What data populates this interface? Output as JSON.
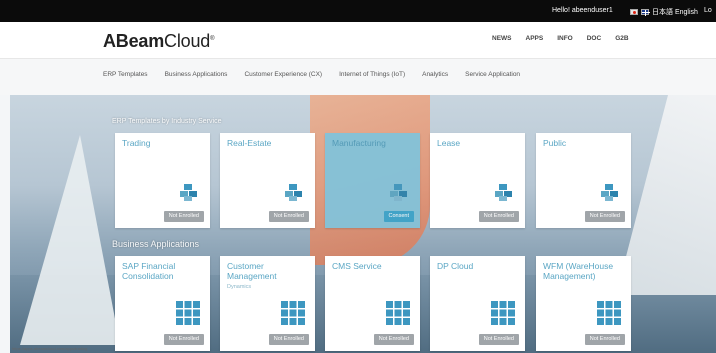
{
  "topbar": {
    "greeting": "Hello! abeenduser1",
    "languages": "日本語 English",
    "logout": "Lo"
  },
  "header": {
    "logo_main": "ABeam",
    "logo_sub": "Cloud",
    "logo_mark": "®",
    "nav": [
      "NEWS",
      "APPS",
      "INFO",
      "DOC",
      "G2B"
    ]
  },
  "categories": [
    "ERP Templates",
    "Business Applications",
    "Customer Experience (CX)",
    "Internet of Things (IoT)",
    "Analytics",
    "Service Application"
  ],
  "sections": {
    "industry": "ERP Templates by Industry Service",
    "business": "Business Applications"
  },
  "industry_tiles": [
    {
      "label": "Trading",
      "button": "Not Enrolled",
      "active": false
    },
    {
      "label": "Real-Estate",
      "button": "Not Enrolled",
      "active": false
    },
    {
      "label": "Manufacturing",
      "button": "Consent",
      "active": true
    },
    {
      "label": "Lease",
      "button": "Not Enrolled",
      "active": false
    },
    {
      "label": "Public",
      "button": "Not Enrolled",
      "active": false
    }
  ],
  "business_tiles": [
    {
      "label": "SAP Financial Consolidation",
      "sub": "",
      "button": "Not Enrolled"
    },
    {
      "label": "Customer Management",
      "sub": "Dynamics",
      "button": "Not Enrolled"
    },
    {
      "label": "CMS Service",
      "sub": "",
      "button": "Not Enrolled"
    },
    {
      "label": "DP Cloud",
      "sub": "",
      "button": "Not Enrolled"
    },
    {
      "label": "WFM (WareHouse Management)",
      "sub": "",
      "button": "Not Enrolled"
    }
  ],
  "status_url": "https://apps.abeamcloud.com/apps/trading",
  "colors": {
    "tile_label": "#5aa6c4",
    "active_tile": "#83c3da",
    "button_inactive": "#a0a5a9",
    "button_active": "#3aa5cc"
  },
  "icons": {
    "industry_tile": "cube-stack-icon",
    "business_tile": "grid-icon"
  }
}
